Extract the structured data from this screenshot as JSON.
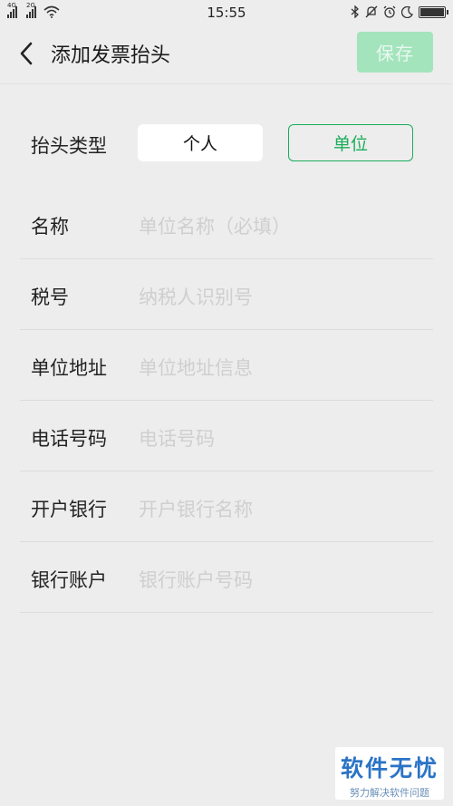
{
  "status_bar": {
    "time": "15:55",
    "sim1": "4G",
    "sim2": "2G"
  },
  "header": {
    "title": "添加发票抬头",
    "save_label": "保存"
  },
  "invoice_type": {
    "label": "抬头类型",
    "options": [
      "个人",
      "单位"
    ],
    "selected": "单位"
  },
  "form": {
    "rows": [
      {
        "label": "名称",
        "placeholder": "单位名称（必填）"
      },
      {
        "label": "税号",
        "placeholder": "纳税人识别号"
      },
      {
        "label": "单位地址",
        "placeholder": "单位地址信息"
      },
      {
        "label": "电话号码",
        "placeholder": "电话号码"
      },
      {
        "label": "开户银行",
        "placeholder": "开户银行名称"
      },
      {
        "label": "银行账户",
        "placeholder": "银行账户号码"
      }
    ]
  },
  "watermark": {
    "title": "软件无忧",
    "subtitle": "努力解决软件问题"
  },
  "colors": {
    "accent": "#1aad5a",
    "save_disabled": "#a3e4bd",
    "background": "#ededed"
  }
}
